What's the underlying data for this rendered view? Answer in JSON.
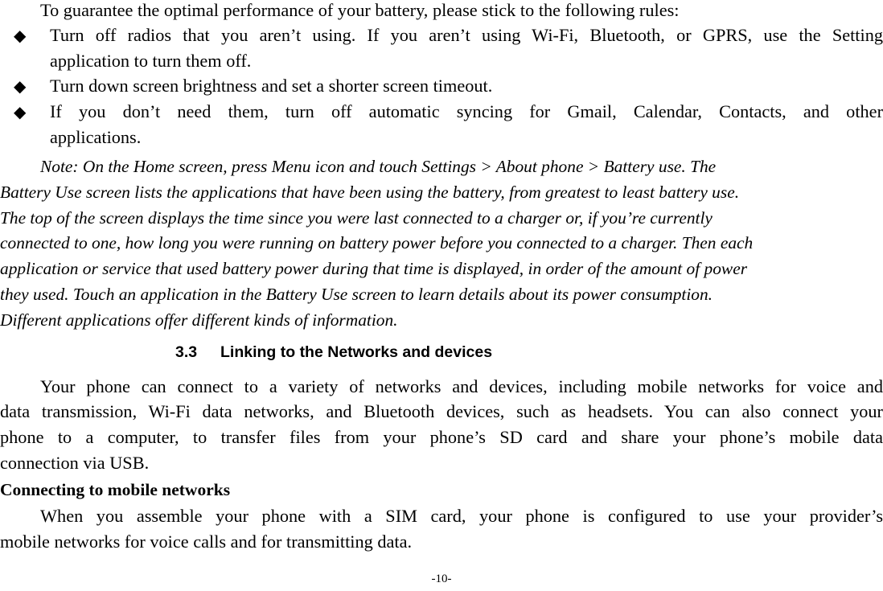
{
  "intro": "To guarantee the optimal performance of your battery, please stick to the following rules:",
  "bullet_icon": "black-diamond",
  "bullets": [
    {
      "lines": [
        "Turn off radios that you aren’t using. If you aren’t using Wi-Fi, Bluetooth, or GPRS, use the Setting",
        "application to turn them off."
      ]
    },
    {
      "lines": [
        "Turn down screen brightness and set a shorter screen timeout."
      ]
    },
    {
      "lines": [
        "If you don’t need them, turn off automatic syncing for Gmail, Calendar, Contacts, and other",
        "applications."
      ]
    }
  ],
  "note": {
    "lines": [
      "Note: On the Home screen, press Menu icon and touch Settings > About phone > Battery use. The",
      "Battery Use screen lists the applications that have been using the battery, from greatest to least battery use.",
      "The top of the screen displays the time since you were last connected to a charger or, if you’re currently",
      "connected to one, how long you were running on battery power before you connected to a charger. Then each",
      "application or service that used battery power during that time is displayed, in order of the amount of power",
      "they used. Touch an application in the Battery Use screen to learn details about its power consumption.",
      "Different applications offer different kinds of information."
    ]
  },
  "section": {
    "number": "3.3",
    "title": "Linking to the Networks and devices"
  },
  "section_body": {
    "lines": [
      "Your phone can connect to a variety of networks and devices, including mobile networks for voice and",
      "data transmission, Wi-Fi data networks, and Bluetooth devices, such as headsets. You can also connect your",
      "phone to a computer, to transfer files from your phone’s SD card and share your phone’s mobile data",
      "connection via USB."
    ]
  },
  "subsection": {
    "title": "Connecting to mobile networks",
    "lines": [
      "When you assemble your phone with a SIM card, your phone is configured to use your provider’s",
      "mobile networks for voice calls and for transmitting data."
    ]
  },
  "page_number": "-10-"
}
